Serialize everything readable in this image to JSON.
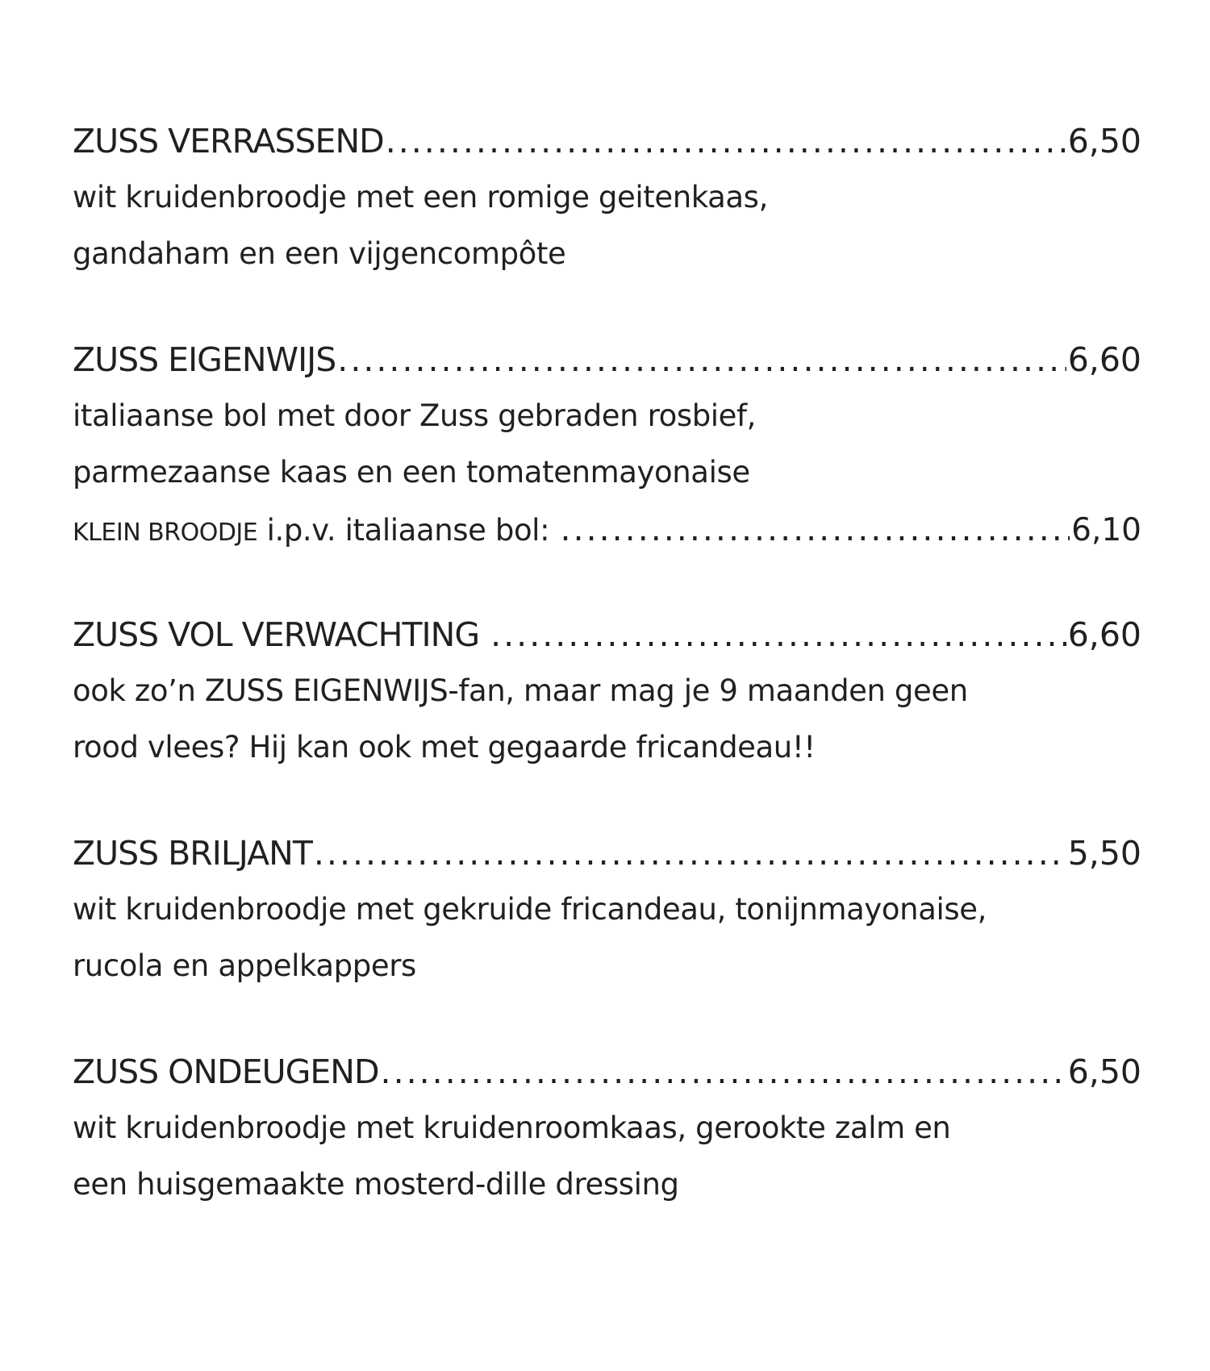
{
  "items": [
    {
      "title": "ZUSS VERRASSEND",
      "price": "6,50",
      "lines": [
        "wit kruidenbroodje met een romige geitenkaas,",
        "gandaham en een vijgencompôte"
      ]
    },
    {
      "title": "ZUSS EIGENWIJS",
      "price": "6,60",
      "lines": [
        "italiaanse bol met door Zuss gebraden rosbief,",
        "parmezaanse kaas en een tomatenmayonaise"
      ],
      "option": {
        "label": "KLEIN BROODJE",
        "text": "i.p.v. italiaanse bol:",
        "price": "6,10"
      }
    },
    {
      "title": "ZUSS VOL VERWACHTING",
      "price": "6,60",
      "lines": [
        "ook zo’n ZUSS EIGENWIJS-fan, maar mag je 9 maanden geen",
        "rood vlees? Hij kan ook met gegaarde fricandeau!!"
      ]
    },
    {
      "title": "ZUSS BRILJANT",
      "price": "5,50",
      "lines": [
        "wit kruidenbroodje met gekruide fricandeau, tonijnmayonaise,",
        "rucola en appelkappers"
      ]
    },
    {
      "title": "ZUSS ONDEUGEND",
      "price": "6,50",
      "lines": [
        "wit kruidenbroodje met kruidenroomkaas, gerookte zalm en",
        "een huisgemaakte mosterd-dille dressing"
      ]
    }
  ]
}
